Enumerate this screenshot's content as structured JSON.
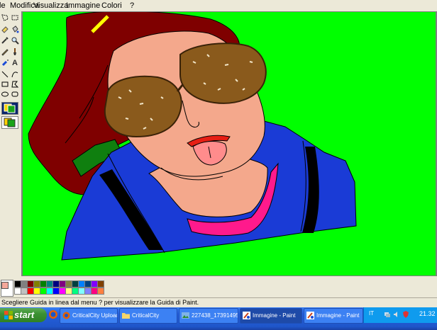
{
  "menu": {
    "file_partial": "le",
    "items": [
      "Modifica",
      "Visualizza",
      "Immagine",
      "Colori",
      "?"
    ]
  },
  "toolbox": {
    "tool_icons": [
      "free-select-icon",
      "rect-select-icon",
      "eraser-icon",
      "fill-icon",
      "eyedropper-icon",
      "magnifier-icon",
      "pencil-icon",
      "brush-icon",
      "airbrush-icon",
      "text-icon",
      "line-icon",
      "curve-icon",
      "rectangle-icon",
      "polygon-icon",
      "ellipse-icon",
      "rounded-rect-icon"
    ],
    "text_tool_glyph": "A"
  },
  "palette": {
    "foreground": "#f4a79a",
    "colors": [
      "#000000",
      "#808080",
      "#800000",
      "#808000",
      "#008000",
      "#008080",
      "#000080",
      "#800080",
      "#808040",
      "#004040",
      "#0080ff",
      "#004080",
      "#8000ff",
      "#804000",
      "#ffffff",
      "#c0c0c0",
      "#ff0000",
      "#ffff00",
      "#00ff00",
      "#00ffff",
      "#0000ff",
      "#ff00ff",
      "#ffff80",
      "#00ff80",
      "#80ffff",
      "#8080ff",
      "#ff0080",
      "#ff8040"
    ]
  },
  "status": {
    "text": "Scegliere Guida in linea dal menu ? per visualizzare la Guida di Paint."
  },
  "taskbar": {
    "start_label": "start",
    "tasks": [
      {
        "label": "CriticalCity Upload...",
        "icon": "browser-icon"
      },
      {
        "label": "CriticalCity",
        "icon": "folder-icon"
      },
      {
        "label": "227438_17391495...",
        "icon": "image-icon"
      },
      {
        "label": "Immagine - Paint",
        "icon": "paint-icon"
      },
      {
        "label": "Immagine - Paint",
        "icon": "paint-icon"
      }
    ],
    "language": "IT",
    "clock": "21.32"
  },
  "colors": {
    "canvas": "#00ff00",
    "taskbar": "#245edb",
    "start": "#3c9133"
  }
}
